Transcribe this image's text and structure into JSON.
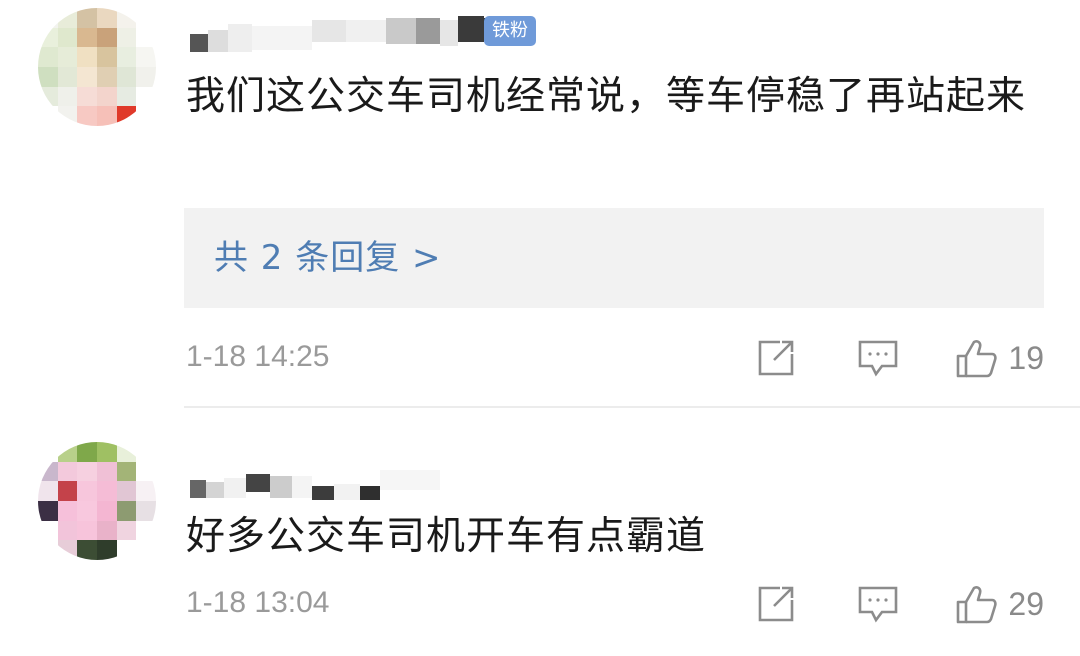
{
  "comments": [
    {
      "badge": "铁粉",
      "content": "我们这公交车司机经常说，等车停稳了再站起来",
      "replies_link": "共 2 条回复 >",
      "time": "1-18 14:25",
      "likes": "19",
      "icons": {
        "share": "share-icon",
        "comment": "comment-icon",
        "like": "thumbs-up-icon"
      }
    },
    {
      "content": "好多公交车司机开车有点霸道",
      "time": "1-18 13:04",
      "likes": "29",
      "icons": {
        "share": "share-icon",
        "comment": "comment-icon",
        "like": "thumbs-up-icon"
      }
    }
  ]
}
